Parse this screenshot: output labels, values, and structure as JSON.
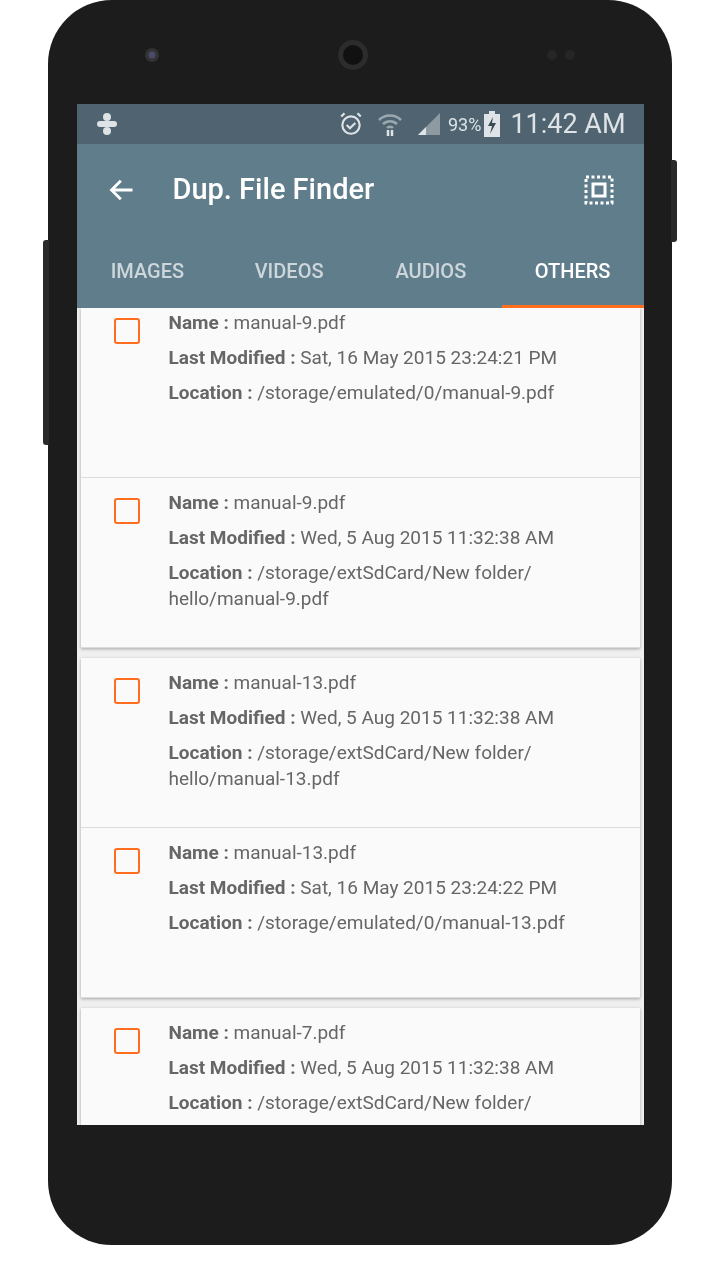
{
  "status_bar": {
    "battery": "93%",
    "time": "11:42 AM"
  },
  "app_bar": {
    "title": "Dup. File Finder"
  },
  "tabs": [
    {
      "label": "IMAGES",
      "selected": false
    },
    {
      "label": "VIDEOS",
      "selected": false
    },
    {
      "label": "AUDIOS",
      "selected": false
    },
    {
      "label": "OTHERS",
      "selected": true
    }
  ],
  "groups": [
    {
      "files": [
        {
          "checked": false,
          "lines": [
            "**Name :** manual-9.pdf",
            "**Last Modified :** Sat, 16 May 2015 23:24:21 PM",
            "**Location :** /storage/emulated/0/manual-9.pdf"
          ]
        },
        {
          "checked": false,
          "lines": [
            "**Name :** manual-9.pdf",
            "**Last Modified :** Wed, 5 Aug 2015 11:32:38 AM",
            "**Location :** /storage/extSdCard/New folder/ hello/manual-9.pdf"
          ]
        }
      ]
    },
    {
      "files": [
        {
          "checked": false,
          "lines": [
            "**Name :** manual-13.pdf",
            "**Last Modified :** Wed, 5 Aug 2015 11:32:38 AM",
            "**Location :** /storage/extSdCard/New folder/ hello/manual-13.pdf"
          ]
        },
        {
          "checked": false,
          "lines": [
            "**Name :** manual-13.pdf",
            "**Last Modified :** Sat, 16 May 2015 23:24:22 PM",
            "**Location :** /storage/emulated/0/manual-13.pdf"
          ]
        }
      ]
    },
    {
      "files": [
        {
          "checked": false,
          "lines": [
            "**Name :** manual-7.pdf",
            "**Last Modified :** Wed, 5 Aug 2015 11:32:38 AM",
            "**Location :** /storage/extSdCard/New folder/"
          ]
        }
      ]
    }
  ]
}
